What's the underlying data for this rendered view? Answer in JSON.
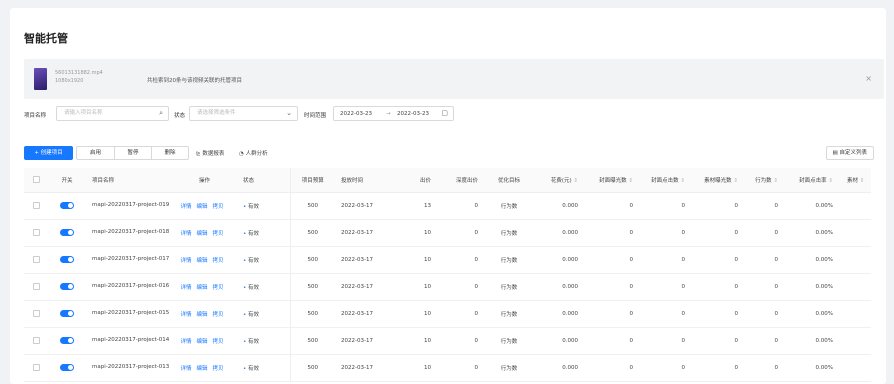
{
  "title": "智能托管",
  "banner": {
    "file_name": "56013131882.mp4",
    "file_dims": "1080x1920",
    "message": "共检索到20条与该视频关联的托管项目",
    "close": "×"
  },
  "filters": {
    "project_label": "项目名称",
    "project_placeholder": "请输入项目名称",
    "status_label": "状态",
    "status_placeholder": "请选择筛选条件",
    "time_label": "时间范围",
    "date_start": "2022-03-23",
    "date_sep": "→",
    "date_end": "2022-03-23"
  },
  "toolbar": {
    "create": "+ 创建项目",
    "enable": "启用",
    "pause": "暂停",
    "delete": "删除",
    "data_report": "数据报表",
    "crowd_analysis": "人群分析",
    "custom_columns": "自定义列表"
  },
  "table": {
    "headers": [
      "开关",
      "项目名称",
      "操作",
      "状态",
      "项目预算",
      "投放时间",
      "出价",
      "深度出价",
      "优化目标",
      "花费(元)",
      "封面曝光数",
      "封面点击数",
      "素材曝光数",
      "行为数",
      "封面点击率",
      "素材"
    ],
    "ops": [
      "详情",
      "编辑",
      "拷贝"
    ],
    "rows": [
      {
        "name": "mapi-20220317-project-019",
        "status": "有效",
        "budget": "500",
        "date": "2022-03-17",
        "bid": "13",
        "deep_bid": "0",
        "target": "行为数",
        "cost": "0.000",
        "cover_exp": "0",
        "cover_clk": "0",
        "mat_exp": "0",
        "actions": "0",
        "ctr": "0.00%"
      },
      {
        "name": "mapi-20220317-project-018",
        "status": "有效",
        "budget": "500",
        "date": "2022-03-17",
        "bid": "10",
        "deep_bid": "0",
        "target": "行为数",
        "cost": "0.000",
        "cover_exp": "0",
        "cover_clk": "0",
        "mat_exp": "0",
        "actions": "0",
        "ctr": "0.00%"
      },
      {
        "name": "mapi-20220317-project-017",
        "status": "有效",
        "budget": "500",
        "date": "2022-03-17",
        "bid": "10",
        "deep_bid": "0",
        "target": "行为数",
        "cost": "0.000",
        "cover_exp": "0",
        "cover_clk": "0",
        "mat_exp": "0",
        "actions": "0",
        "ctr": "0.00%"
      },
      {
        "name": "mapi-20220317-project-016",
        "status": "有效",
        "budget": "500",
        "date": "2022-03-17",
        "bid": "10",
        "deep_bid": "0",
        "target": "行为数",
        "cost": "0.000",
        "cover_exp": "0",
        "cover_clk": "0",
        "mat_exp": "0",
        "actions": "0",
        "ctr": "0.00%"
      },
      {
        "name": "mapi-20220317-project-015",
        "status": "有效",
        "budget": "500",
        "date": "2022-03-17",
        "bid": "10",
        "deep_bid": "0",
        "target": "行为数",
        "cost": "0.000",
        "cover_exp": "0",
        "cover_clk": "0",
        "mat_exp": "0",
        "actions": "0",
        "ctr": "0.00%"
      },
      {
        "name": "mapi-20220317-project-014",
        "status": "有效",
        "budget": "500",
        "date": "2022-03-17",
        "bid": "10",
        "deep_bid": "0",
        "target": "行为数",
        "cost": "0.000",
        "cover_exp": "0",
        "cover_clk": "0",
        "mat_exp": "0",
        "actions": "0",
        "ctr": "0.00%"
      },
      {
        "name": "mapi-20220317-project-013",
        "status": "有效",
        "budget": "500",
        "date": "2022-03-17",
        "bid": "10",
        "deep_bid": "0",
        "target": "行为数",
        "cost": "0.000",
        "cover_exp": "0",
        "cover_clk": "0",
        "mat_exp": "0",
        "actions": "0",
        "ctr": "0.00%"
      }
    ]
  },
  "colors": {
    "accent": "#1677ff"
  }
}
